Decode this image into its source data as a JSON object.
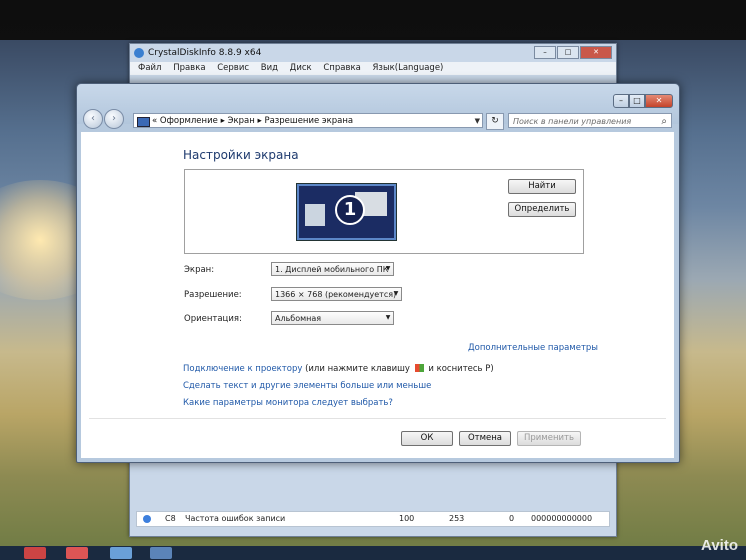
{
  "background_window": {
    "title": "CrystalDiskInfo 8.8.9 x64",
    "menu": [
      "Файл",
      "Правка",
      "Сервис",
      "Вид",
      "Диск",
      "Справка",
      "Язык(Language)"
    ],
    "row": {
      "id": "C8",
      "name": "Частота ошибок записи",
      "v1": "100",
      "v2": "253",
      "v3": "0",
      "raw": "000000000000"
    }
  },
  "window": {
    "breadcrumb": [
      "«",
      "Оформление",
      "Экран",
      "Разрешение экрана"
    ],
    "search_placeholder": "Поиск в панели управления",
    "heading": "Настройки экрана",
    "monitor_number": "1",
    "find_button": "Найти",
    "identify_button": "Определить",
    "screen_label": "Экран:",
    "screen_value": "1. Дисплей мобильного ПК",
    "resolution_label": "Разрешение:",
    "resolution_value": "1366 × 768 (рекомендуется)",
    "orientation_label": "Ориентация:",
    "orientation_value": "Альбомная",
    "advanced_link": "Дополнительные параметры",
    "projector_link": "Подключение к проектору",
    "projector_text_a": "(или нажмите клавишу",
    "projector_text_b": "и коснитесь P)",
    "text_size_link": "Сделать текст и другие элементы больше или меньше",
    "which_settings_link": "Какие параметры монитора следует выбрать?",
    "ok_button": "ОК",
    "cancel_button": "Отмена",
    "apply_button": "Применить"
  },
  "watermark": "Avito"
}
